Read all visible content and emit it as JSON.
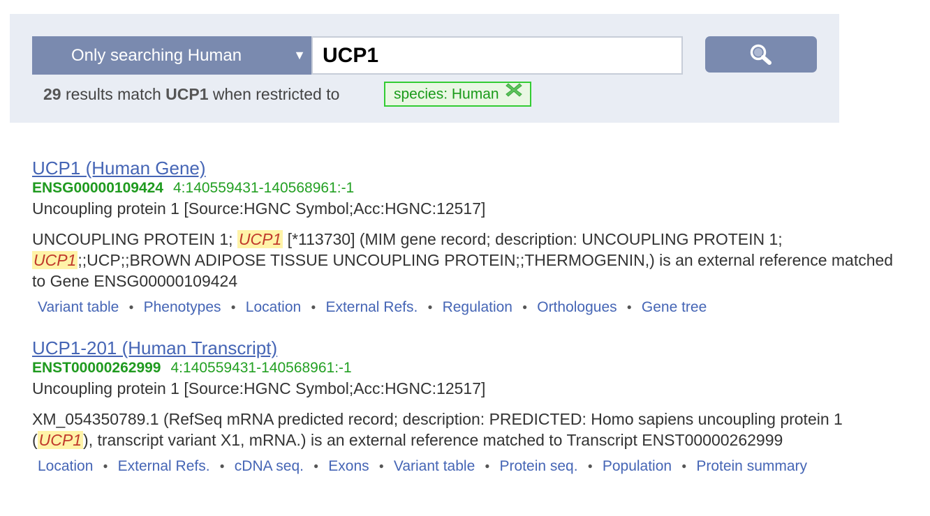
{
  "search": {
    "species_label": "Only searching Human",
    "query": "UCP1",
    "summary_count": "29",
    "summary_mid": "results match",
    "summary_query": "UCP1",
    "summary_tail": "when restricted to",
    "filter_tag": "species: Human"
  },
  "results": [
    {
      "title": "UCP1 (Human Gene)",
      "stable_id": "ENSG00000109424",
      "location": "4:140559431-140568961:-1",
      "description": "Uncoupling protein 1 [Source:HGNC Symbol;Acc:HGNC:12517]",
      "xref": {
        "p1": "UNCOUPLING PROTEIN 1; ",
        "h1": "UCP1",
        "p2": " [*113730] (MIM gene record; description: UNCOUPLING PROTEIN 1; ",
        "h2": "UCP1",
        "p3": ";;UCP;;BROWN ADIPOSE TISSUE UNCOUPLING PROTEIN;;THERMOGENIN,) is an external reference matched to Gene ENSG00000109424"
      },
      "links": [
        "Variant table",
        "Phenotypes",
        "Location",
        "External Refs.",
        "Regulation",
        "Orthologues",
        "Gene tree"
      ]
    },
    {
      "title": "UCP1-201 (Human Transcript)",
      "stable_id": "ENST00000262999",
      "location": "4:140559431-140568961:-1",
      "description": "Uncoupling protein 1 [Source:HGNC Symbol;Acc:HGNC:12517]",
      "xref": {
        "p1": "XM_054350789.1 (RefSeq mRNA predicted record; description: PREDICTED: Homo sapiens uncoupling protein 1 (",
        "h1": "UCP1",
        "p2": "), transcript variant X1, mRNA.) is an external reference matched to Transcript ENST00000262999"
      },
      "links": [
        "Location",
        "External Refs.",
        "cDNA seq.",
        "Exons",
        "Variant table",
        "Protein seq.",
        "Population",
        "Protein summary"
      ]
    }
  ],
  "colors": {
    "panel_bg": "#e9edf4",
    "button_bg": "#7a8aaf",
    "link": "#4565b5",
    "id_green": "#1f9a1f",
    "filter_border": "#33cc33",
    "highlight_bg": "#fff3a8"
  },
  "icons": {
    "search_button": "magnifier-icon",
    "filter_remove": "remove-x-icon",
    "dropdown": "triangle-down-icon"
  }
}
